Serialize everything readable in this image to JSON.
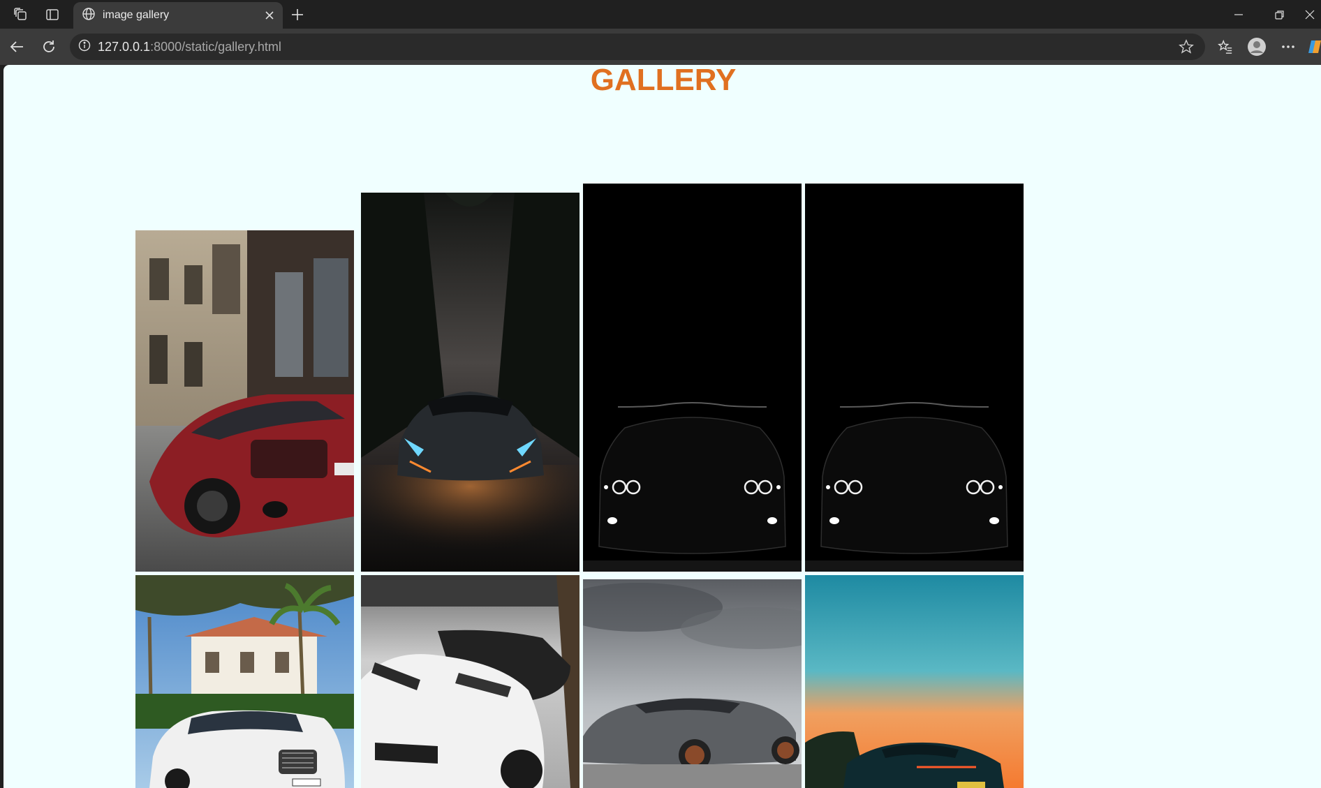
{
  "browser": {
    "tab_title": "image gallery",
    "url_host": "127.0.0.1",
    "url_path": ":8000/static/gallery.html"
  },
  "page": {
    "title": "GALLERY",
    "background": "#f0ffff",
    "title_color": "#e07020"
  },
  "gallery": {
    "images": [
      {
        "subject": "red sports car beside building"
      },
      {
        "subject": "dark supercar on foggy forest road"
      },
      {
        "subject": "black car front in darkness"
      },
      {
        "subject": "black car front in darkness"
      },
      {
        "subject": "white SUV in front of villa with palm trees"
      },
      {
        "subject": "white supercar close-up"
      },
      {
        "subject": "grey supercar under cloudy sky"
      },
      {
        "subject": "car at sunset over sea"
      }
    ]
  }
}
